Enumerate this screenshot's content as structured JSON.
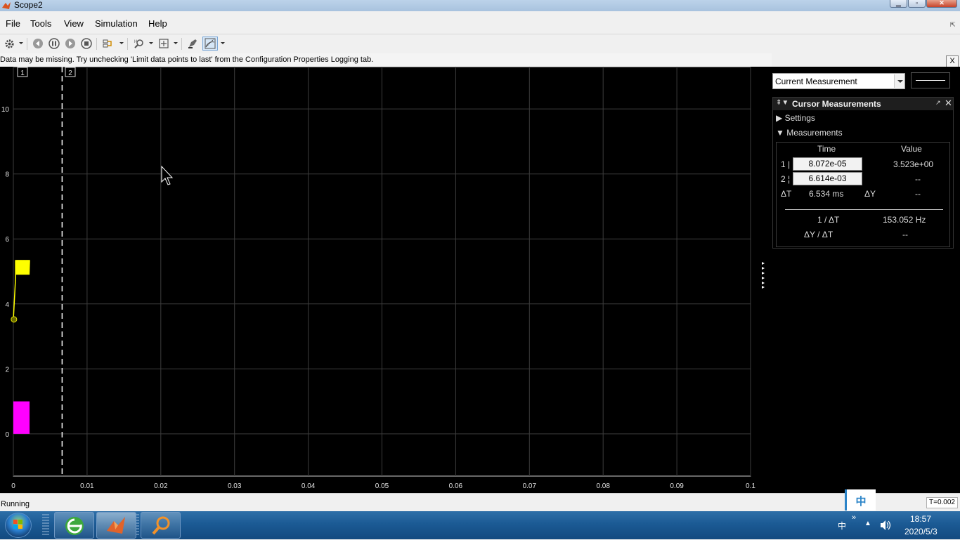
{
  "window": {
    "title": "Scope2"
  },
  "menu": {
    "items": [
      "File",
      "Tools",
      "View",
      "Simulation",
      "Help"
    ]
  },
  "toolbar": {
    "icons": [
      "gear-icon",
      "step-back-icon",
      "pause-icon",
      "step-forward-icon",
      "stop-icon",
      "signal-select-icon",
      "zoom-icon",
      "autoscale-icon",
      "highlight-icon",
      "cursor-measure-icon"
    ]
  },
  "warning": {
    "text": "Data may be missing.  Try unchecking 'Limit data points to last' from the Configuration Properties Logging tab.",
    "close_label": "X"
  },
  "plot": {
    "cursor_labels": [
      "1",
      "2"
    ],
    "y_ticks": [
      "10",
      "8",
      "6",
      "4",
      "2",
      "0"
    ],
    "x_ticks": [
      "0",
      "0.01",
      "0.02",
      "0.03",
      "0.04",
      "0.05",
      "0.06",
      "0.07",
      "0.08",
      "0.09",
      "0.1"
    ],
    "xlim": [
      0,
      0.1
    ],
    "ylim": [
      -1.3,
      11.3
    ],
    "cursor1_time": 8.072e-05,
    "cursor2_time": 0.006614,
    "series": [
      {
        "color": "#ffff00",
        "approx_range": [
          4.9,
          5.35
        ],
        "t_end": 0.0022
      },
      {
        "color": "#ff00ff",
        "approx_range": [
          0,
          1
        ],
        "t_end": 0.0022
      }
    ],
    "marker_value": 3.523,
    "colors": {
      "background": "#000000",
      "grid": "#3c3c3c",
      "tick_text": "#e0e0e0",
      "yellow": "#ffff00",
      "magenta": "#ff00ff"
    }
  },
  "measure_select": {
    "value": "Current Measurement"
  },
  "cursor_panel": {
    "title": "Cursor Measurements",
    "settings_label": "Settings",
    "measurements_label": "Measurements",
    "col_time": "Time",
    "col_value": "Value",
    "row1_label": "1 |",
    "row1_time": "8.072e-05",
    "row1_value": "3.523e+00",
    "row2_label": "2 ¦",
    "row2_time": "6.614e-03",
    "row2_value": "--",
    "dt_label": "ΔT",
    "dt_value": "6.534 ms",
    "dy_label": "ΔY",
    "dy_value": "--",
    "inv_dt_label": "1 / ΔT",
    "inv_dt_value": "153.052 Hz",
    "dydt_label": "ΔY / ΔT",
    "dydt_value": "--"
  },
  "status": {
    "text": "Running",
    "time": "T=0.002",
    "ime": "中"
  },
  "taskbar": {
    "time": "18:57",
    "date": "2020/5/3",
    "lang": "中"
  }
}
